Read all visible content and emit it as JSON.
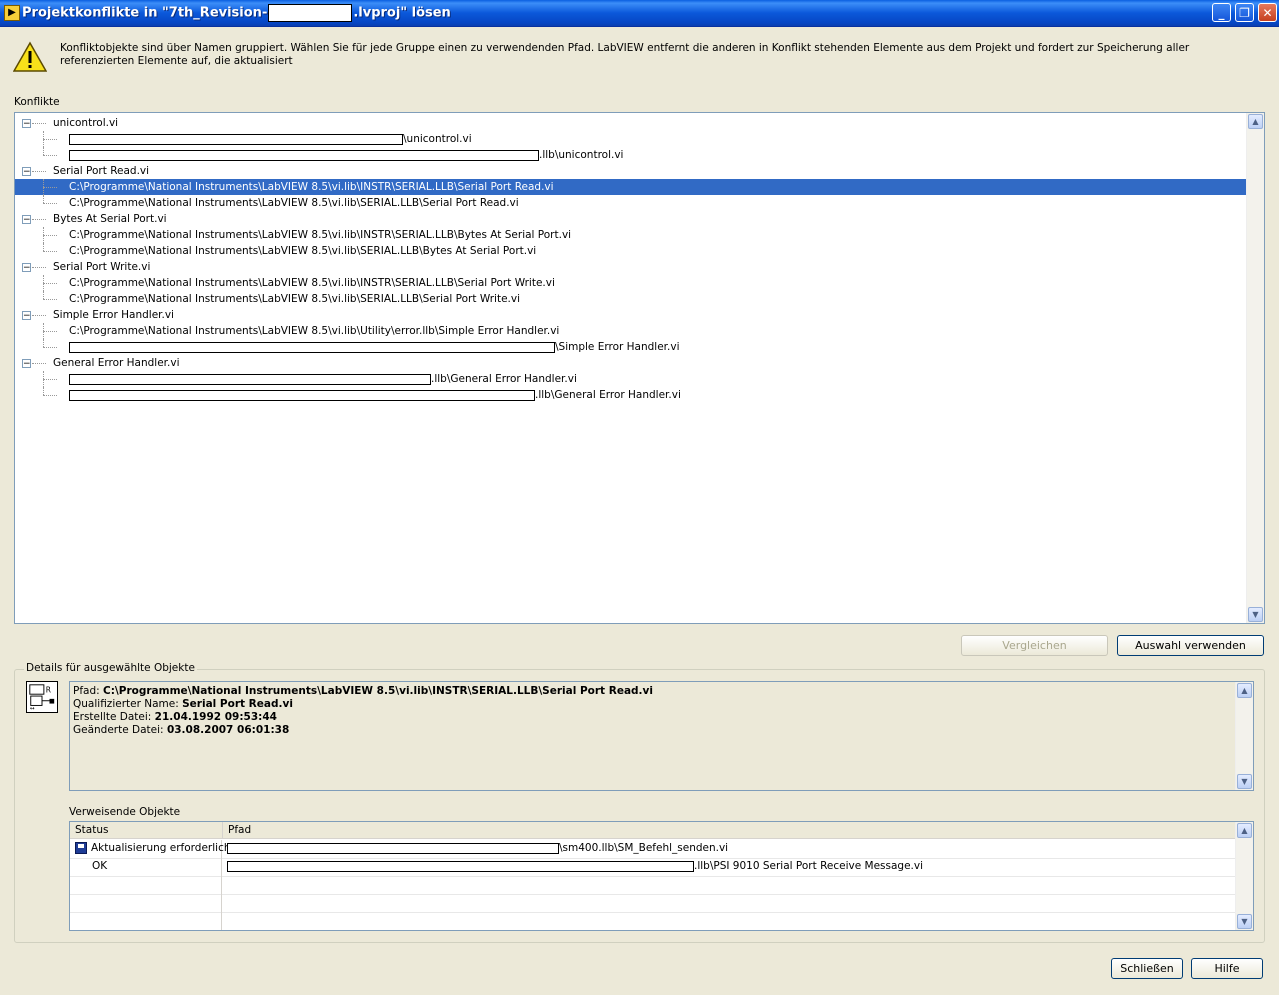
{
  "window": {
    "title_prefix": "Projektkonflikte in \"7th_Revision-",
    "title_suffix": ".lvproj\" lösen"
  },
  "info": {
    "text": "Konfliktobjekte sind über Namen gruppiert.  Wählen Sie für jede Gruppe einen zu verwendenden Pfad.  LabVIEW entfernt die anderen in Konflikt stehenden Elemente aus dem Projekt und fordert zur Speicherung aller referenzierten Elemente auf, die aktualisiert"
  },
  "conflicts": {
    "label": "Konflikte",
    "groups": [
      {
        "name": "unicontrol.vi",
        "paths": [
          "\\unicontrol.vi",
          ".llb\\unicontrol.vi"
        ]
      },
      {
        "name": "Serial Port Read.vi",
        "paths": [
          "C:\\Programme\\National Instruments\\LabVIEW 8.5\\vi.lib\\INSTR\\SERIAL.LLB\\Serial Port Read.vi",
          "C:\\Programme\\National Instruments\\LabVIEW 8.5\\vi.lib\\SERIAL.LLB\\Serial Port Read.vi"
        ]
      },
      {
        "name": "Bytes At Serial Port.vi",
        "paths": [
          "C:\\Programme\\National Instruments\\LabVIEW 8.5\\vi.lib\\INSTR\\SERIAL.LLB\\Bytes At Serial Port.vi",
          "C:\\Programme\\National Instruments\\LabVIEW 8.5\\vi.lib\\SERIAL.LLB\\Bytes At Serial Port.vi"
        ]
      },
      {
        "name": "Serial Port Write.vi",
        "paths": [
          "C:\\Programme\\National Instruments\\LabVIEW 8.5\\vi.lib\\INSTR\\SERIAL.LLB\\Serial Port Write.vi",
          "C:\\Programme\\National Instruments\\LabVIEW 8.5\\vi.lib\\SERIAL.LLB\\Serial Port Write.vi"
        ]
      },
      {
        "name": "Simple Error Handler.vi",
        "paths": [
          "C:\\Programme\\National Instruments\\LabVIEW 8.5\\vi.lib\\Utility\\error.llb\\Simple Error Handler.vi",
          "\\Simple Error Handler.vi"
        ]
      },
      {
        "name": "General Error Handler.vi",
        "paths": [
          ".llb\\General Error Handler.vi",
          ".llb\\General Error Handler.vi"
        ]
      }
    ],
    "selected": "Serial Port Read.vi / INSTR"
  },
  "buttons": {
    "compare": "Vergleichen",
    "use_selection": "Auswahl verwenden",
    "close": "Schließen",
    "help": "Hilfe"
  },
  "details": {
    "legend": "Details für ausgewählte Objekte",
    "path_label": "Pfad:",
    "path_value": "C:\\Programme\\National Instruments\\LabVIEW 8.5\\vi.lib\\INSTR\\SERIAL.LLB\\Serial Port Read.vi",
    "qname_label": "Qualifizierter Name:",
    "qname_value": "Serial Port Read.vi",
    "created_label": "Erstellte Datei:",
    "created_value": "21.04.1992 09:53:44",
    "modified_label": "Geänderte Datei:",
    "modified_value": "03.08.2007 06:01:38"
  },
  "references": {
    "label": "Verweisende Objekte",
    "col_status": "Status",
    "col_path": "Pfad",
    "rows": [
      {
        "status": "Aktualisierung erforderlich",
        "path": "\\sm400.llb\\SM_Befehl_senden.vi"
      },
      {
        "status": "OK",
        "path": ".llb\\PSI 9010 Serial Port Receive Message.vi"
      }
    ]
  },
  "icons": {
    "title": "labview-icon",
    "warning": "warning-icon",
    "object": "vi-icon",
    "status": "save-disk-icon"
  },
  "colors": {
    "selection": "#316ac5",
    "titlebar": "#0a58da",
    "dialog": "#ece9d8"
  }
}
